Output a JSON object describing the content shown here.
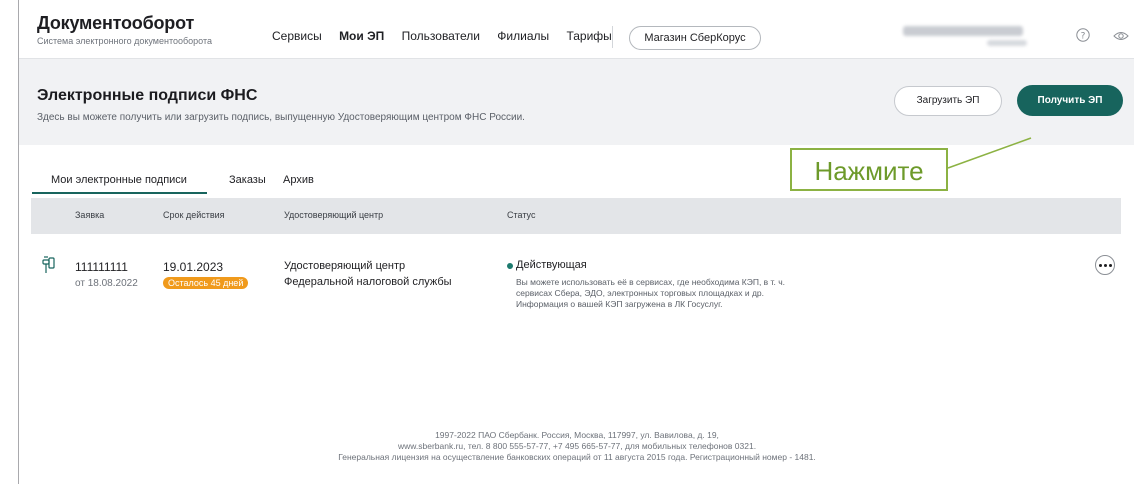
{
  "header": {
    "logo_title": "Документооборот",
    "logo_subtitle": "Система электронного документооборота",
    "nav": [
      "Сервисы",
      "Мои ЭП",
      "Пользователи",
      "Филиалы",
      "Тарифы"
    ],
    "nav_active": "Мои ЭП",
    "store_button": "Магазин СберКорус",
    "icons": [
      "help-icon",
      "eye-icon"
    ]
  },
  "banner": {
    "title": "Электронные подписи ФНС",
    "subtitle": "Здесь вы можете получить или загрузить подпись, выпущенную Удостоверяющим центром ФНС России.",
    "upload_button": "Загрузить ЭП",
    "get_button": "Получить ЭП"
  },
  "tabs": [
    {
      "label": "Мои электронные подписи",
      "active": true
    },
    {
      "label": "Заказы",
      "active": false
    },
    {
      "label": "Архив",
      "active": false
    }
  ],
  "table": {
    "headers": [
      "Заявка",
      "Срок действия",
      "Удостоверяющий центр",
      "Статус"
    ],
    "rows": [
      {
        "number": "111111111",
        "date": "от 18.08.2022",
        "expiry": "19.01.2023",
        "remaining": "Осталось 45 дней",
        "ca_line1": "Удостоверяющий центр",
        "ca_line2": "Федеральной налоговой службы",
        "status": "Действующая",
        "status_desc": [
          "Вы можете использовать её в сервисах, где необходима КЭП, в т. ч.",
          "сервисах Сбера, ЭДО, электронных торговых площадках и др.",
          "Информация о вашей КЭП загружена в ЛК Госуслуг."
        ]
      }
    ]
  },
  "footer": [
    "1997-2022 ПАО Сбербанк. Россия, Москва, 117997, ул. Вавилова, д. 19,",
    "www.sberbank.ru, тел. 8 800 555-57-77, +7 495 665-57-77, для мобильных телефонов 0321.",
    "Генеральная лицензия на осуществление банковских операций от 11 августа 2015 года. Регистрационный номер - 1481."
  ],
  "callout": "Нажмите",
  "colors": {
    "accent": "#17645d",
    "badge": "#f09a1c",
    "callout": "#8cb243",
    "banner_bg": "#f1f2f4",
    "table_header_bg": "#e3e5e8"
  }
}
